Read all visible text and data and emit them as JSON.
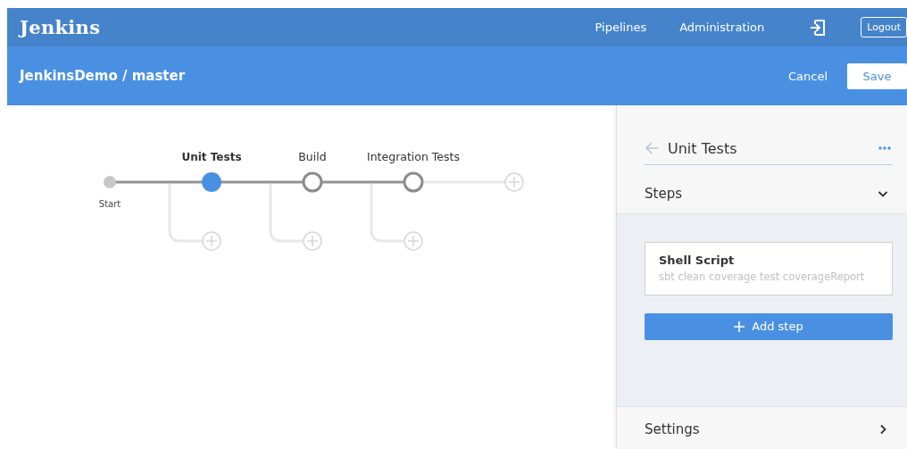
{
  "header": {
    "brand": "Jenkins",
    "nav": [
      "Pipelines",
      "Administration"
    ],
    "logout": "Logout"
  },
  "subheader": {
    "title": "JenkinsDemo / master",
    "cancel": "Cancel",
    "save": "Save"
  },
  "pipeline": {
    "start_label": "Start",
    "stages": [
      {
        "label": "Unit Tests",
        "selected": true
      },
      {
        "label": "Build",
        "selected": false
      },
      {
        "label": "Integration Tests",
        "selected": false
      }
    ]
  },
  "panel": {
    "title": "Unit Tests",
    "sections": [
      {
        "title": "Steps",
        "expanded": true,
        "steps": [
          {
            "name": "Shell Script",
            "command": "sbt clean coverage test coverageReport"
          }
        ],
        "add_label": "Add step"
      },
      {
        "title": "Settings",
        "expanded": false
      }
    ]
  }
}
